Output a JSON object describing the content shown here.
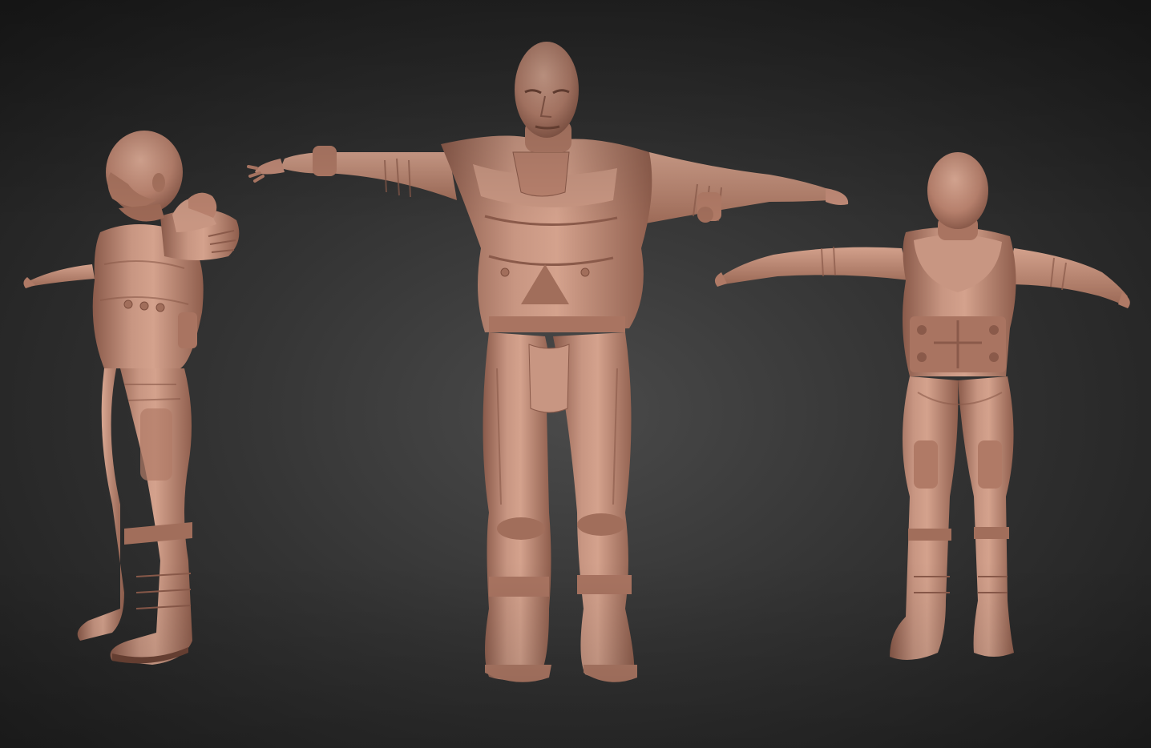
{
  "scene": {
    "background_color": "#2e2e2e",
    "clay_color": "#c08a77",
    "clay_shadow": "#8a5a4a",
    "clay_highlight": "#d9a792",
    "views": [
      {
        "name": "side-view",
        "subject": "character-sculpt"
      },
      {
        "name": "front-view",
        "subject": "character-sculpt"
      },
      {
        "name": "back-view",
        "subject": "character-sculpt"
      }
    ]
  }
}
